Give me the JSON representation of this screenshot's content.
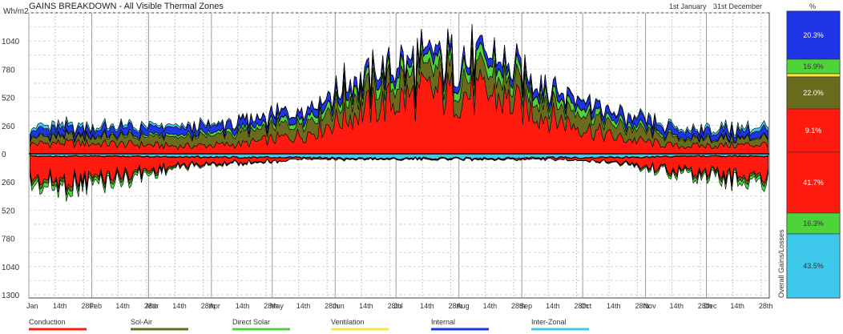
{
  "window": {
    "title": "GAINS BREAKDOWN - All Visible Thermal Zones",
    "period_start": "1st January",
    "period_end": "31st December",
    "side_header": "%",
    "side_axis_label": "Overall Gains/Losses"
  },
  "chart_data": {
    "type": "area",
    "title": "GAINS BREAKDOWN - All Visible Thermal Zones",
    "ylabel": "Wh/m2",
    "ylim": [
      -1300,
      1300
    ],
    "y_ticks": [
      1040,
      780,
      520,
      260,
      0,
      260,
      520,
      780,
      1040,
      1300
    ],
    "x_ticks": [
      "Jan",
      "14th",
      "28th",
      "Feb",
      "14th",
      "28th",
      "Mar",
      "14th",
      "28th",
      "Apr",
      "14th",
      "28th",
      "May",
      "14th",
      "28th",
      "Jun",
      "14th",
      "28th",
      "Jul",
      "14th",
      "28th",
      "Aug",
      "14th",
      "28th",
      "Sep",
      "14th",
      "28th",
      "Oct",
      "14th",
      "28th",
      "Nov",
      "14th",
      "28th",
      "Dec",
      "14th",
      "28th"
    ],
    "grid": true,
    "legend_position": "bottom",
    "months": [
      "Jan",
      "Feb",
      "Mar",
      "Apr",
      "May",
      "Jun",
      "Jul",
      "Aug",
      "Sep",
      "Oct",
      "Nov",
      "Dec"
    ],
    "series": [
      {
        "name": "Conduction",
        "color": "#ff1a10",
        "gain_monthly": [
          100,
          90,
          70,
          90,
          180,
          420,
          560,
          540,
          330,
          150,
          70,
          80
        ],
        "loss_monthly": [
          -220,
          -160,
          -70,
          -40,
          -15,
          -5,
          -5,
          -5,
          -15,
          -35,
          -120,
          -170
        ]
      },
      {
        "name": "Sol-Air",
        "color": "#6b6b1e",
        "gain_monthly": [
          60,
          70,
          80,
          100,
          130,
          160,
          170,
          170,
          150,
          110,
          70,
          60
        ],
        "loss_monthly": [
          -30,
          -25,
          -10,
          -5,
          0,
          0,
          0,
          0,
          0,
          -5,
          -15,
          -25
        ]
      },
      {
        "name": "Direct Solar",
        "color": "#4ed43a",
        "gain_monthly": [
          10,
          15,
          20,
          30,
          50,
          70,
          90,
          90,
          70,
          40,
          15,
          10
        ],
        "loss_monthly": [
          -40,
          -30,
          -10,
          -5,
          0,
          0,
          0,
          0,
          0,
          -5,
          -20,
          -35
        ]
      },
      {
        "name": "Ventilation",
        "color": "#f4e83a",
        "gain_monthly": [
          0,
          0,
          0,
          0,
          5,
          5,
          5,
          5,
          5,
          0,
          0,
          0
        ],
        "loss_monthly": [
          -5,
          -5,
          -5,
          -5,
          -5,
          -5,
          -5,
          -5,
          -5,
          -5,
          -5,
          -5
        ]
      },
      {
        "name": "Internal",
        "color": "#1e34e6",
        "gain_monthly": [
          60,
          60,
          60,
          60,
          70,
          70,
          70,
          70,
          70,
          60,
          60,
          60
        ],
        "loss_monthly": [
          0,
          0,
          0,
          0,
          0,
          0,
          0,
          0,
          0,
          0,
          0,
          0
        ]
      },
      {
        "name": "Inter-Zonal",
        "color": "#3ec8ec",
        "gain_monthly": [
          30,
          20,
          20,
          10,
          5,
          0,
          0,
          0,
          5,
          10,
          20,
          30
        ],
        "loss_monthly": [
          -20,
          -20,
          -25,
          -30,
          -35,
          -40,
          -40,
          -40,
          -35,
          -30,
          -20,
          -20
        ]
      }
    ],
    "overall_percentages": [
      {
        "label": "20.3%",
        "color": "#1e34e6"
      },
      {
        "label": "16.9%",
        "color": "#4ed43a"
      },
      {
        "label": "",
        "color": "#f4e83a"
      },
      {
        "label": "22.0%",
        "color": "#6b6b1e"
      },
      {
        "label": "9.1%",
        "color": "#ff1a10"
      },
      {
        "label": "41.7%",
        "color": "#ff1a10"
      },
      {
        "label": "16.3%",
        "color": "#4ed43a"
      },
      {
        "label": "43.5%",
        "color": "#3ec8ec"
      }
    ]
  }
}
